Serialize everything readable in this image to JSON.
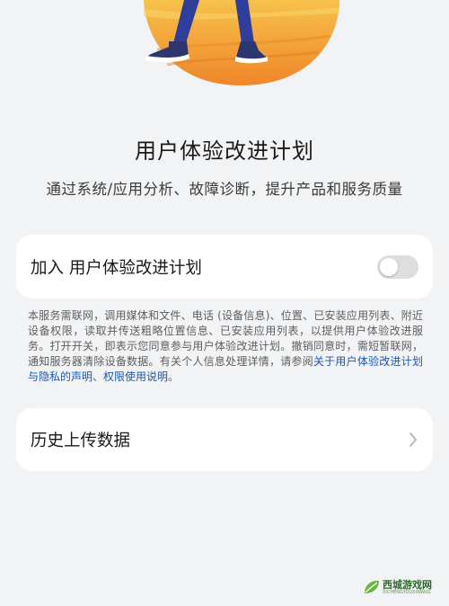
{
  "colors": {
    "page_bg": "#f1f3f5",
    "card_bg": "#ffffff",
    "link": "#1c57b5",
    "toggle_off": "#dedede",
    "hero_orange": "#f2a033",
    "hero_blue": "#2f3e9a"
  },
  "hero": {
    "illustration_icon": "person-walking-illustration"
  },
  "header": {
    "title": "用户体验改进计划",
    "subtitle": "通过系统/应用分析、故障诊断，提升产品和服务质量"
  },
  "join_card": {
    "label": "加入 用户体验改进计划",
    "toggle_state": "off"
  },
  "description": {
    "text": "本服务需联网，调用媒体和文件、电话 (设备信息)、位置、已安装应用列表、附近设备权限，读取并传送粗略位置信息、已安装应用列表，以提供用户体验改进服务。打开开关，即表示您同意参与用户体验改进计划。撤销同意时，需短暂联网，通知服务器清除设备数据。有关个人信息处理详情，请参阅",
    "link_privacy": "关于用户体验改进计划与隐私的声明",
    "separator": "、",
    "link_permissions": "权限使用说明",
    "end": "。"
  },
  "history_card": {
    "label": "历史上传数据",
    "chevron_icon": "chevron-right-icon"
  },
  "watermark": {
    "text": "西城游戏网",
    "subtext": "XICHENGYOUXIWANG",
    "icon": "leaf-logo-icon"
  }
}
